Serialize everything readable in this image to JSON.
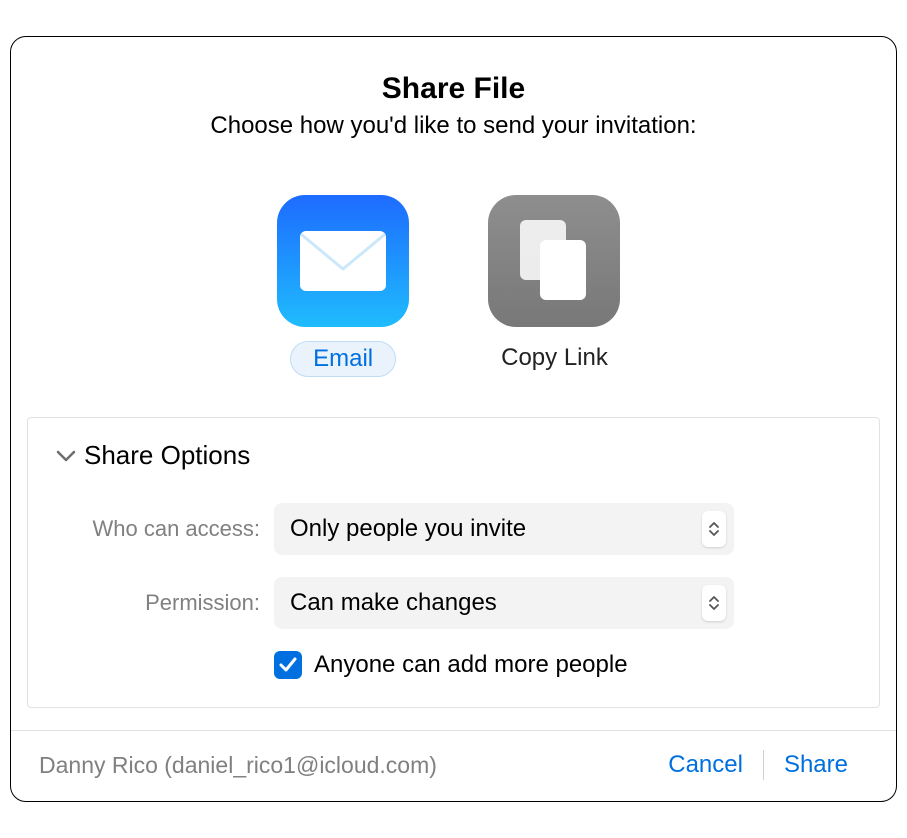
{
  "header": {
    "title": "Share File",
    "subtitle": "Choose how you'd like to send your invitation:"
  },
  "methods": {
    "email": {
      "label": "Email",
      "selected": true
    },
    "copyLink": {
      "label": "Copy Link",
      "selected": false
    }
  },
  "options": {
    "title": "Share Options",
    "access": {
      "label": "Who can access:",
      "value": "Only people you invite"
    },
    "permission": {
      "label": "Permission:",
      "value": "Can make changes"
    },
    "addPeople": {
      "label": "Anyone can add more people",
      "checked": true
    }
  },
  "footer": {
    "user": "Danny Rico (daniel_rico1@icloud.com)",
    "cancel": "Cancel",
    "share": "Share"
  }
}
